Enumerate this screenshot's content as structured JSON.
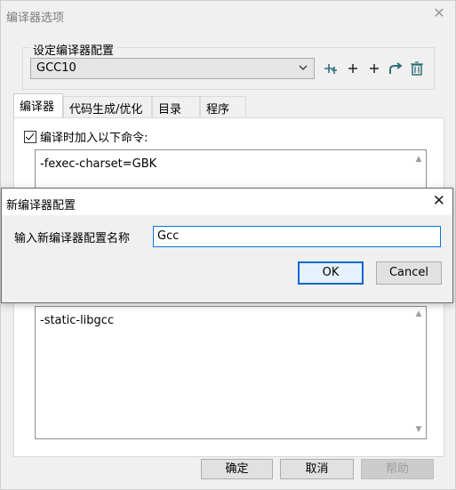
{
  "window": {
    "title": "编译器选项",
    "close_glyph": "✕"
  },
  "config_group": {
    "label": "设定编译器配置",
    "selected": "GCC10",
    "toolbar": [
      {
        "name": "rename-config-icon",
        "glyph": "⁺‡"
      },
      {
        "name": "add-config-icon",
        "glyph": "+"
      },
      {
        "name": "add-config-2-icon",
        "glyph": "+"
      },
      {
        "name": "share-config-icon",
        "glyph": "↱"
      },
      {
        "name": "delete-config-icon",
        "glyph": "🗑"
      }
    ]
  },
  "tabs": [
    "编译器",
    "代码生成/优化",
    "目录",
    "程序"
  ],
  "compiler_tab": {
    "checkbox_label": "编译时加入以下命令:",
    "compile_options": "-fexec-charset=GBK",
    "linker_options": "-static-libgcc"
  },
  "buttons": {
    "ok": "确定",
    "cancel": "取消",
    "help": "帮助"
  },
  "dialog": {
    "title": "新编译器配置",
    "close_glyph": "✕",
    "prompt": "输入新编译器配置名称",
    "input_value": "Gcc",
    "ok": "OK",
    "cancel": "Cancel"
  },
  "colors": {
    "accent_blue": "#0a67d1",
    "toolbar_teal": "#2f6f77"
  }
}
